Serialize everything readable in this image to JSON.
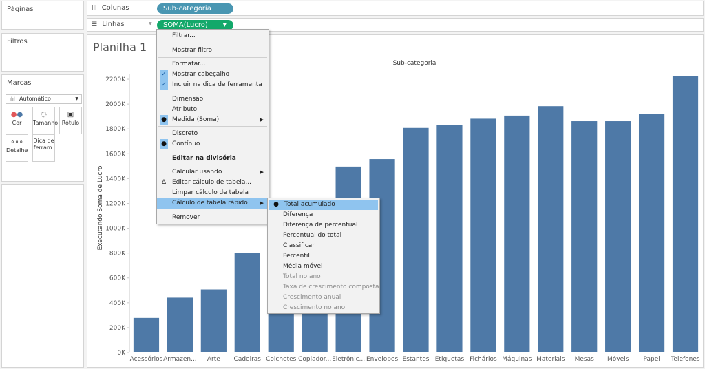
{
  "sidebar": {
    "paginas_title": "Páginas",
    "filtros_title": "Filtros",
    "marcas_title": "Marcas",
    "marks_type": "Automático",
    "cards": [
      {
        "label": "Cor",
        "icon": "color-dots-icon"
      },
      {
        "label": "Tamanho",
        "icon": "size-icon"
      },
      {
        "label": "Rótulo",
        "icon": "text-label-icon"
      },
      {
        "label": "Detalhe",
        "icon": "detail-dots-icon"
      },
      {
        "label": "Dica de ferram.",
        "icon": "tooltip-icon"
      }
    ]
  },
  "shelves": {
    "colunas_label": "Colunas",
    "colunas_pill": "Sub-categoria",
    "linhas_label": "Linhas",
    "linhas_pill": "SOMA(Lucro)"
  },
  "sheet": {
    "title": "Planilha 1"
  },
  "context_menu": {
    "items": [
      {
        "label": "Filtrar..."
      },
      {
        "label": "Mostrar filtro"
      },
      {
        "label": "Formatar..."
      },
      {
        "label": "Mostrar cabeçalho",
        "checked": true
      },
      {
        "label": "Incluir na dica de ferramenta",
        "checked": true
      },
      {
        "label": "Dimensão"
      },
      {
        "label": "Atributo"
      },
      {
        "label": "Medida (Soma)",
        "bullet": true,
        "submenu": true
      },
      {
        "label": "Discreto"
      },
      {
        "label": "Contínuo",
        "bullet": true
      },
      {
        "label": "Editar na divisória",
        "bold": true
      },
      {
        "label": "Calcular usando",
        "submenu": true
      },
      {
        "label": "Editar cálculo de tabela..."
      },
      {
        "label": "Limpar cálculo de tabela"
      },
      {
        "label": "Cálculo de tabela rápido",
        "submenu": true,
        "highlighted": true
      },
      {
        "label": "Remover"
      }
    ]
  },
  "quick_calc_menu": {
    "items": [
      {
        "label": "Total acumulado",
        "bullet": true,
        "highlighted": true
      },
      {
        "label": "Diferença"
      },
      {
        "label": "Diferença de percentual"
      },
      {
        "label": "Percentual do total"
      },
      {
        "label": "Classificar"
      },
      {
        "label": "Percentil"
      },
      {
        "label": "Média móvel"
      },
      {
        "label": "Total no ano",
        "disabled": true
      },
      {
        "label": "Taxa de crescimento composta",
        "disabled": true
      },
      {
        "label": "Crescimento anual",
        "disabled": true
      },
      {
        "label": "Crescimento no ano",
        "disabled": true
      }
    ]
  },
  "chart_data": {
    "type": "bar",
    "title": "Sub-categoria",
    "ylabel": "Executando Soma de Lucro",
    "xlabel": "",
    "ylim": [
      0,
      2300
    ],
    "yticks": [
      "0K",
      "200K",
      "400K",
      "600K",
      "800K",
      "1000K",
      "1200K",
      "1400K",
      "1600K",
      "1800K",
      "2000K",
      "2200K"
    ],
    "ytick_values": [
      0,
      200,
      400,
      600,
      800,
      1000,
      1200,
      1400,
      1600,
      1800,
      2000,
      2200
    ],
    "grid": false,
    "bar_color": "#4e79a7",
    "categories": [
      "Acessórios",
      "Armazen...",
      "Arte",
      "Cadeiras",
      "Colchetes",
      "Copiador...",
      "Eletrônic...",
      "Envelopes",
      "Estantes",
      "Etiquetas",
      "Fichários",
      "Máquinas",
      "Materiais",
      "Mesas",
      "Móveis",
      "Papel",
      "Telefones"
    ],
    "values": [
      278,
      441,
      507,
      800,
      920,
      1180,
      1497,
      1557,
      1808,
      1830,
      1882,
      1907,
      1983,
      1862,
      1862,
      1922,
      2225
    ]
  }
}
